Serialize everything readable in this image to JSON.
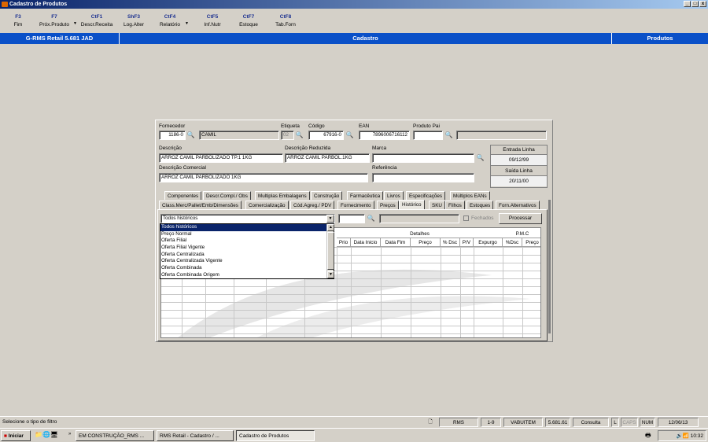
{
  "window": {
    "title": "Cadastro de Produtos",
    "min": "_",
    "max": "□",
    "close": "x"
  },
  "toolbar": [
    {
      "key": "F3",
      "label": "Fim",
      "arrow": ""
    },
    {
      "key": "F7",
      "label": "Próx.Produto",
      "arrow": "▼"
    },
    {
      "key": "CtF1",
      "label": "Descr.Receita",
      "arrow": ""
    },
    {
      "key": "ShF3",
      "label": "Log.Alter",
      "arrow": ""
    },
    {
      "key": "CtF4",
      "label": "Relatório",
      "arrow": "▼"
    },
    {
      "key": "CtF5",
      "label": "Inf.Nutr",
      "arrow": ""
    },
    {
      "key": "CtF7",
      "label": "Estoque",
      "arrow": ""
    },
    {
      "key": "CtF8",
      "label": "Tab.Forn",
      "arrow": ""
    }
  ],
  "bluebar": {
    "app": "G-RMS Retail 5.681 JAD",
    "center": "Cadastro",
    "right": "Produtos"
  },
  "form": {
    "fornecedor_label": "Fornecedor",
    "fornecedor_code": "1186-0",
    "fornecedor_name": "CAMIL",
    "etiqueta_label": "Etiqueta",
    "etiqueta_value": "02",
    "codigo_label": "Código",
    "codigo_value": "67916-0",
    "ean_label": "EAN",
    "ean_value": "7896006716112",
    "produto_pai_label": "Produto Pai",
    "produto_pai_value": "",
    "descricao_label": "Descrição",
    "descricao_value": "ARROZ CAMIL PARBOLIZADO TP.1 1KG",
    "desc_reduzida_label": "Descrição Reduzida",
    "desc_reduzida_value": "ARROZ CAMIL PARBOL.1KG",
    "marca_label": "Marca",
    "marca_value": "",
    "desc_comercial_label": "Descrição Comercial",
    "desc_comercial_value": "ARROZ CAMIL PARBOLIZADO 1KG",
    "referencia_label": "Referência",
    "referencia_value": "",
    "entrada_label": "Entrada Linha",
    "entrada_value": "09/12/99",
    "saida_label": "Saída Linha",
    "saida_value": "20/11/00"
  },
  "tabs_row1": [
    "Componentes",
    "Descr.Compl./ Obs",
    "Multiplas Embalagens",
    "Construção",
    "Farmacêutica",
    "Livros",
    "Especificações",
    "Múltiplos EANs"
  ],
  "tabs_row2": [
    "Class.Merc/Pallet/Emb/Dimensões",
    "Comercialização",
    "Cód.Agreg./ PDV",
    "Fornecimento",
    "Preços",
    "Histórico",
    "SKU",
    "Filhos",
    "Estoques",
    "Forn.Alternativos"
  ],
  "historico": {
    "filter_selected": "Todos históricos",
    "filter_options": [
      "Todos históricos",
      "Preço Normal",
      "Oferta Filial",
      "Oferta Filial Vigente",
      "Oferta Centralizada",
      "Oferta Centralizada Vigente",
      "Oferta Combinada",
      "Oferta Combinada Origem"
    ],
    "fechados_label": "Fechados",
    "processar_label": "Processar",
    "group_detalhes": "Detalhes",
    "group_pmc": "P.M.C",
    "columns": [
      "Prio",
      "Data Inicio",
      "Data Fim",
      "Preço",
      "% Dsc",
      "P/V",
      "Expurgo",
      "%Dsc",
      "Preço"
    ]
  },
  "statusbar": {
    "message": "Selecione o tipo de filtro",
    "system": "RMS",
    "page": "1-9",
    "user": "VABUITEM",
    "version": "5.681.61",
    "mode": "Consulta",
    "l": "L",
    "caps": "CAPS",
    "num": "NUM",
    "date": "12/06/13"
  },
  "taskbar": {
    "start": "Iniciar",
    "tasks": [
      "EM CONSTRUÇÃO_RMS ...",
      "RMS Retail - Cadastro / ...",
      "Cadastro de Produtos"
    ],
    "clock": "10:32"
  }
}
